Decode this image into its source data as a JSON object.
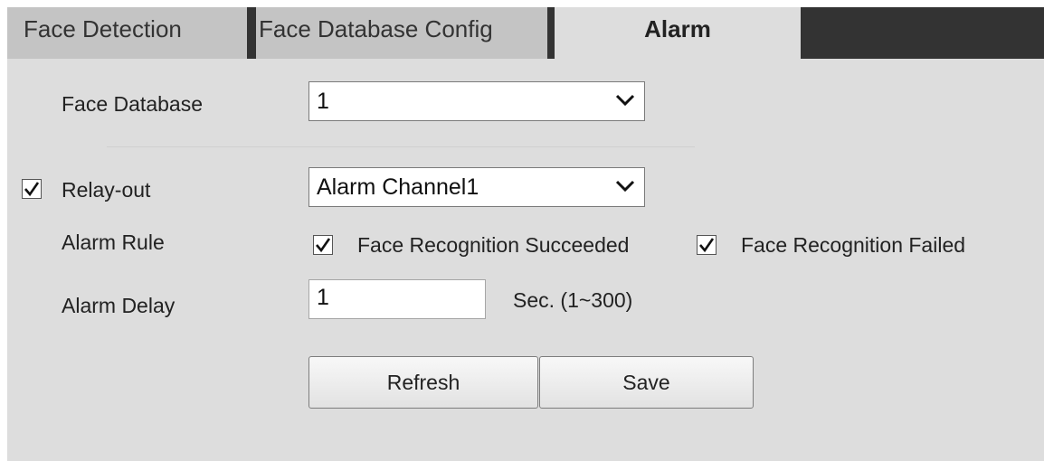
{
  "tabs": [
    {
      "label": "Face Detection",
      "active": false
    },
    {
      "label": "Face Database Config",
      "active": false
    },
    {
      "label": "Alarm",
      "active": true
    }
  ],
  "form": {
    "face_database": {
      "label": "Face Database",
      "value": "1"
    },
    "relay_out": {
      "label": "Relay-out",
      "checked": true,
      "value": "Alarm Channel1"
    },
    "alarm_rule": {
      "label": "Alarm Rule",
      "options": [
        {
          "label": "Face Recognition Succeeded",
          "checked": true
        },
        {
          "label": "Face Recognition Failed",
          "checked": true
        }
      ]
    },
    "alarm_delay": {
      "label": "Alarm Delay",
      "value": "1",
      "unit": "Sec. (1~300)"
    }
  },
  "buttons": {
    "refresh": "Refresh",
    "save": "Save"
  },
  "colors": {
    "tab_bar": "#333333",
    "tab_inactive": "#c4c4c4",
    "panel": "#dddddd"
  },
  "icons": {
    "dropdown": "chevron-down-icon",
    "check": "checkmark-icon"
  }
}
